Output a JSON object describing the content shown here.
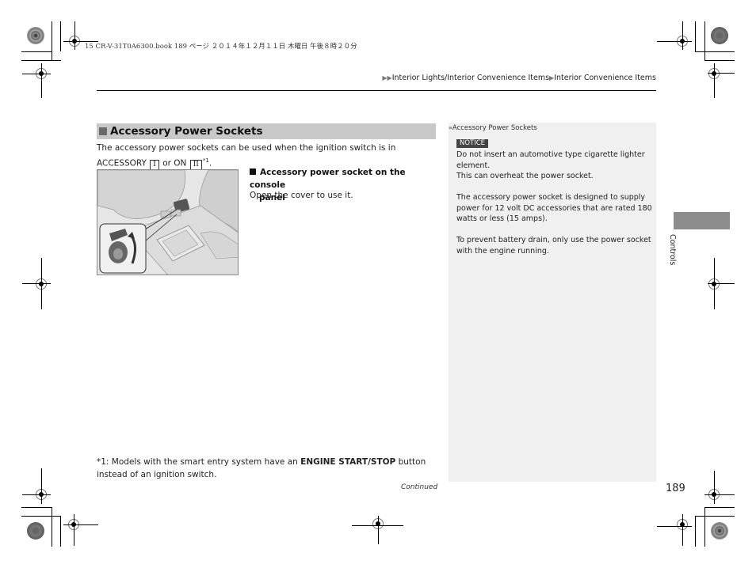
{
  "print_header": {
    "meta_line": "15 CR-V-31T0A6300.book  189 ページ  ２０１４年１２月１１日  木曜日  午後８時２０分"
  },
  "breadcrumb": {
    "marker": "▶▶",
    "items": [
      "Interior Lights/Interior Convenience Items",
      "Interior Convenience Items"
    ],
    "separator": "▶"
  },
  "section": {
    "title": "Accessory Power Sockets",
    "intro_before": "The accessory power sockets can be used when the ignition switch is in ACCESSORY",
    "key_accessory": "I",
    "intro_or": "or ON",
    "key_on": "II",
    "footnote_ref": "*1",
    "intro_end": "."
  },
  "figure": {
    "description": "Center console with accessory power socket and open cover inset",
    "icon": "power-socket-illustration"
  },
  "subsection": {
    "heading_line1": "Accessory power socket on the console",
    "heading_line2": "panel",
    "body": "Open the cover to use it."
  },
  "footnote": {
    "prefix": "*1: Models with the smart entry system have an ",
    "bold": "ENGINE START/STOP",
    "suffix": " button instead of an ignition switch."
  },
  "continued_label": "Continued",
  "sidebar": {
    "marker": "»",
    "title": "Accessory Power Sockets",
    "notice_label": "NOTICE",
    "paragraphs": [
      "Do not insert an automotive type cigarette lighter element.\nThis can overheat the power socket.",
      "The accessory power socket is designed to supply power for 12 volt DC accessories that are rated 180 watts or less (15 amps).",
      "To prevent battery drain, only use the power socket with the engine running."
    ]
  },
  "chapter_tab": {
    "label": "Controls"
  },
  "page_number": "189"
}
